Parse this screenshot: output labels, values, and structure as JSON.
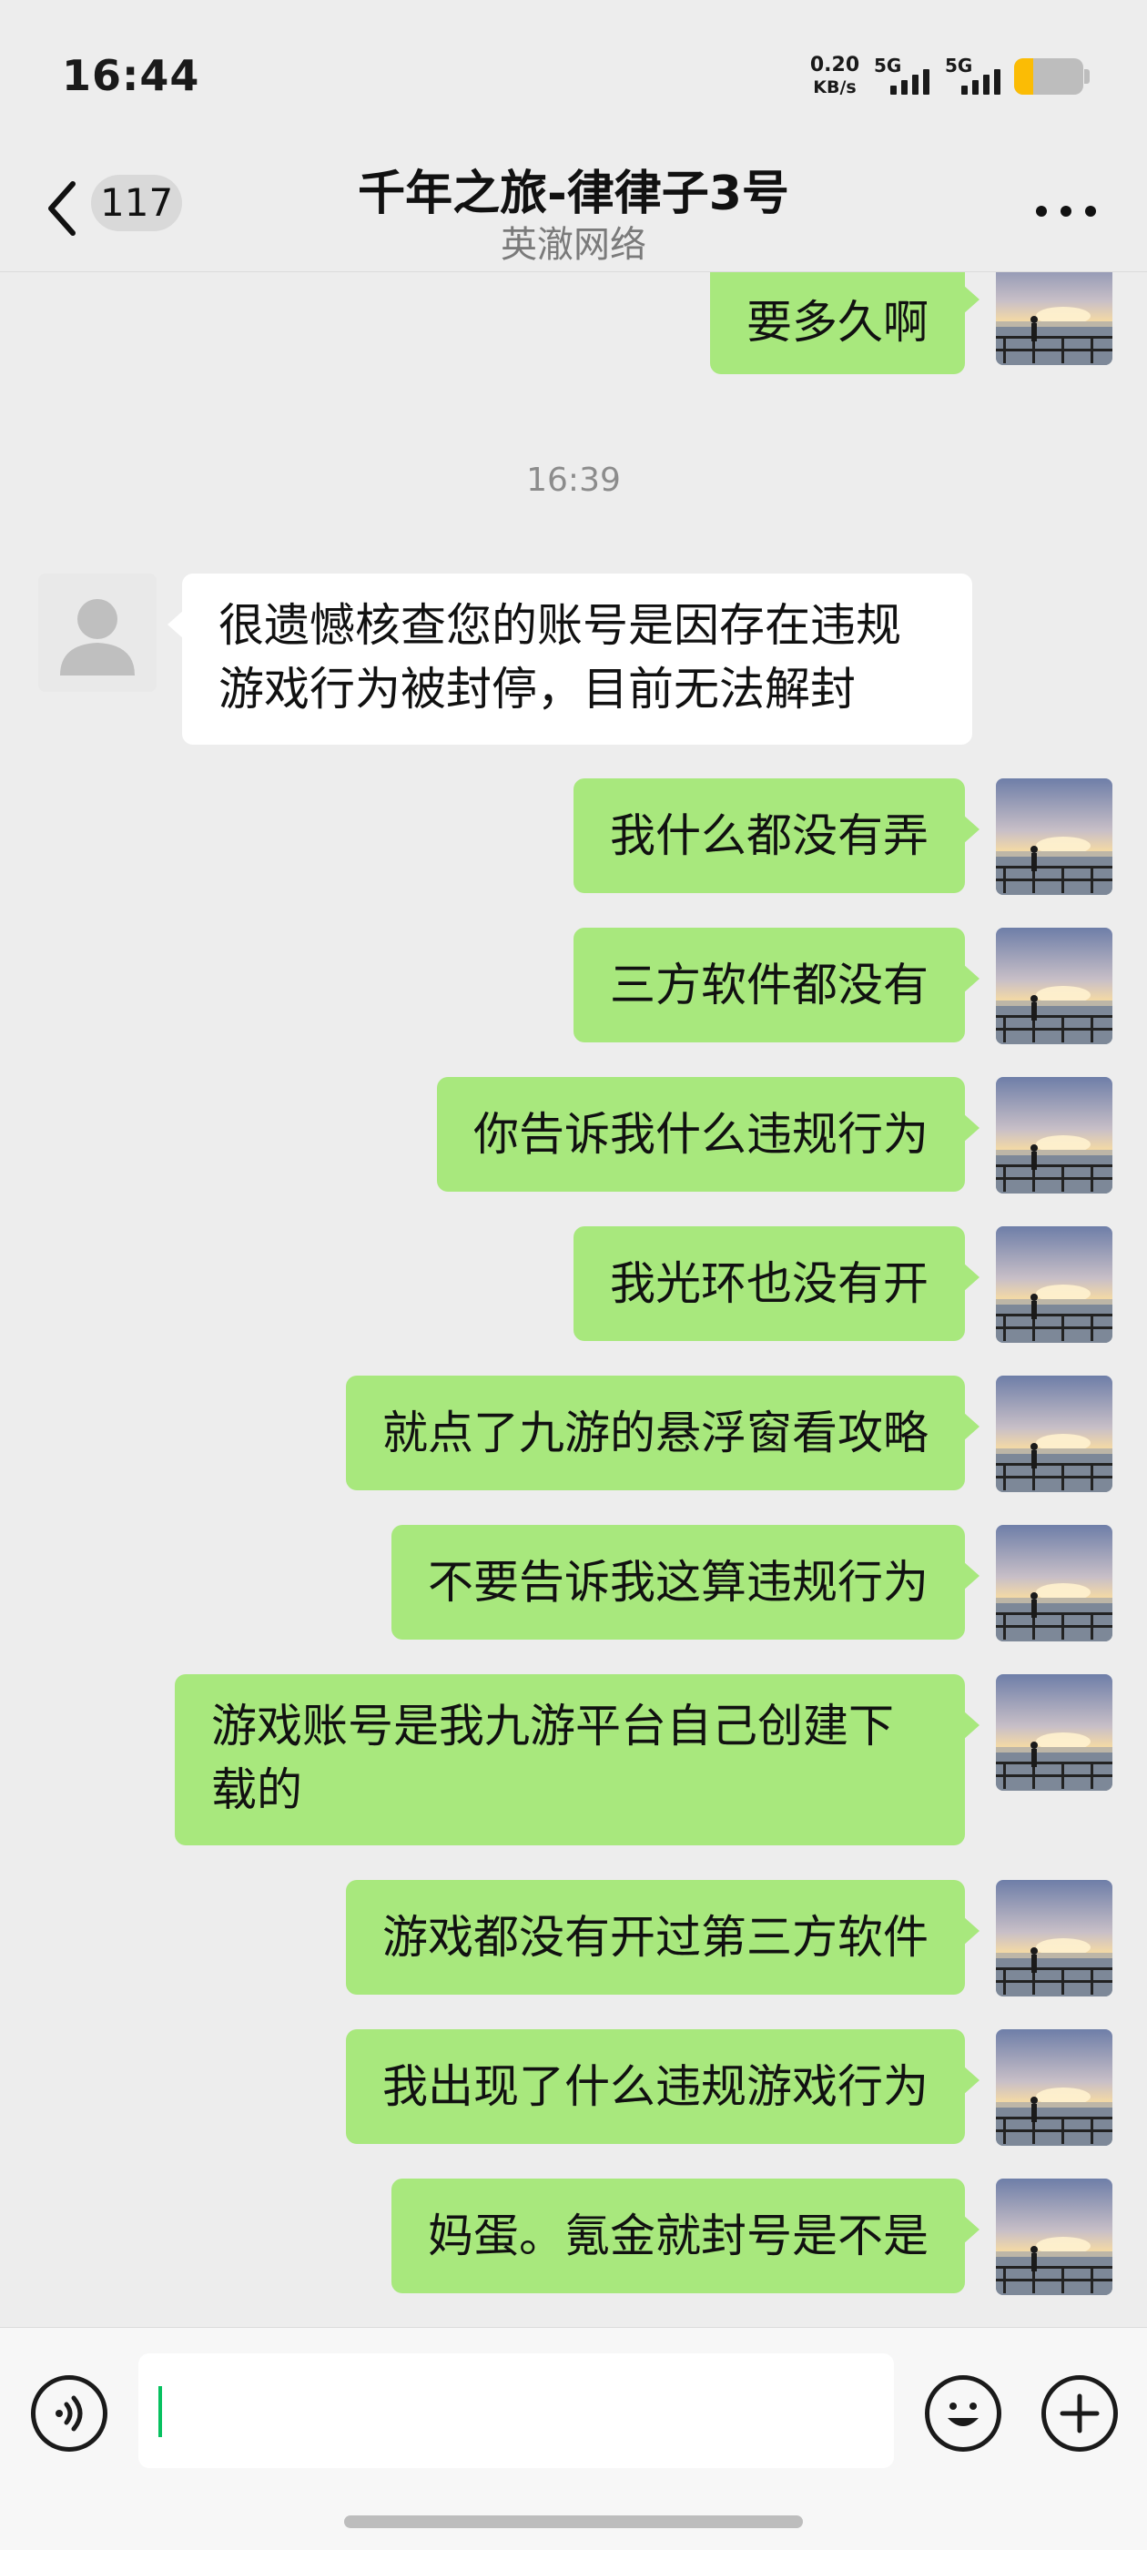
{
  "status_bar": {
    "time": "16:44",
    "net_speed_value": "0.20",
    "net_speed_unit": "KB/s",
    "signal_1_label": "5G",
    "signal_2_label": "5G",
    "battery_level": 0.28,
    "battery_color": "#fbbc05"
  },
  "header": {
    "unread_count": "117",
    "title": "千年之旅-律律子3号",
    "subtitle": "英澈网络",
    "back_icon": "chevron-left-icon",
    "more_icon": "more-dots-icon"
  },
  "colors": {
    "self_bubble": "#a8e87d",
    "other_bubble": "#ffffff",
    "background": "#ededed",
    "cursor": "#07c160"
  },
  "messages": [
    {
      "sender": "self",
      "text": "要多久啊"
    },
    {
      "type": "timestamp",
      "text": "16:39"
    },
    {
      "sender": "other",
      "text": "很遗憾核查您的账号是因存在违规游戏行为被封停，目前无法解封"
    },
    {
      "sender": "self",
      "text": "我什么都没有弄"
    },
    {
      "sender": "self",
      "text": "三方软件都没有"
    },
    {
      "sender": "self",
      "text": "你告诉我什么违规行为"
    },
    {
      "sender": "self",
      "text": "我光环也没有开"
    },
    {
      "sender": "self",
      "text": "就点了九游的悬浮窗看攻略"
    },
    {
      "sender": "self",
      "text": "不要告诉我这算违规行为"
    },
    {
      "sender": "self",
      "text": "游戏账号是我九游平台自己创建下载的"
    },
    {
      "sender": "self",
      "text": "游戏都没有开过第三方软件"
    },
    {
      "sender": "self",
      "text": "我出现了什么违规游戏行为"
    },
    {
      "sender": "self",
      "text": "妈蛋。氪金就封号是不是"
    }
  ],
  "input_bar": {
    "voice_icon": "voice-icon",
    "emoji_icon": "emoji-icon",
    "plus_icon": "plus-icon",
    "input_value": ""
  }
}
